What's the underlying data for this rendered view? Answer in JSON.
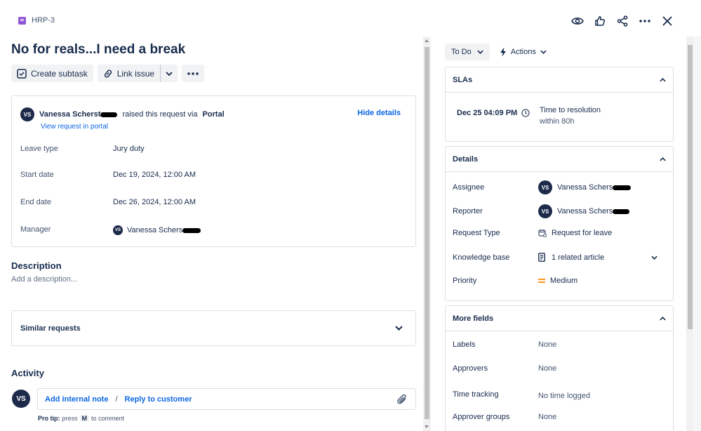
{
  "header": {
    "issue_key": "HRP-3"
  },
  "issue": {
    "title": "No for reals...I need a break",
    "toolbar": {
      "create_subtask": "Create subtask",
      "link_issue": "Link issue"
    },
    "request": {
      "reporter_initials": "VS",
      "reporter_name": "Vanessa Scherst",
      "raised_text": "raised this request via",
      "channel": "Portal",
      "view_in_portal": "View request in portal",
      "hide_details": "Hide details",
      "fields": [
        {
          "label": "Leave type",
          "value": "Jury duty"
        },
        {
          "label": "Start date",
          "value": "Dec 19, 2024, 12:00 AM"
        },
        {
          "label": "End date",
          "value": "Dec 26, 2024, 12:00 AM"
        },
        {
          "label": "Manager",
          "value": "Vanessa Schers",
          "initials": "VS"
        }
      ]
    },
    "description": {
      "label": "Description",
      "placeholder": "Add a description..."
    },
    "similar_requests": "Similar requests",
    "activity": {
      "label": "Activity",
      "initials": "VS",
      "add_internal_note": "Add internal note",
      "separator": "/",
      "reply_to_customer": "Reply to customer",
      "pro_tip_label": "Pro tip:",
      "pro_tip_press": "press",
      "pro_tip_key": "M",
      "pro_tip_rest": "to comment"
    }
  },
  "sidebar": {
    "status": "To Do",
    "actions": "Actions",
    "slas": {
      "label": "SLAs",
      "date": "Dec 25 04:09 PM",
      "name": "Time to resolution",
      "remaining": "within 80h"
    },
    "details": {
      "label": "Details",
      "assignee_label": "Assignee",
      "assignee_initials": "VS",
      "assignee_name": "Vanessa Schers",
      "reporter_label": "Reporter",
      "reporter_initials": "VS",
      "reporter_name": "Vanessa Schers",
      "request_type_label": "Request Type",
      "request_type": "Request for leave",
      "kb_label": "Knowledge base",
      "kb_value": "1 related article",
      "priority_label": "Priority",
      "priority": "Medium"
    },
    "more_fields": {
      "label": "More fields",
      "rows": [
        {
          "label": "Labels",
          "value": "None"
        },
        {
          "label": "Approvers",
          "value": "None"
        },
        {
          "label": "Time tracking",
          "value": "No time logged"
        },
        {
          "label": "Approver groups",
          "value": "None"
        }
      ]
    }
  },
  "colors": {
    "link": "#0c66e4",
    "avatar": "#1d2a4a",
    "issue_type": "#8f57d6",
    "priority_medium": "#ff991f"
  }
}
